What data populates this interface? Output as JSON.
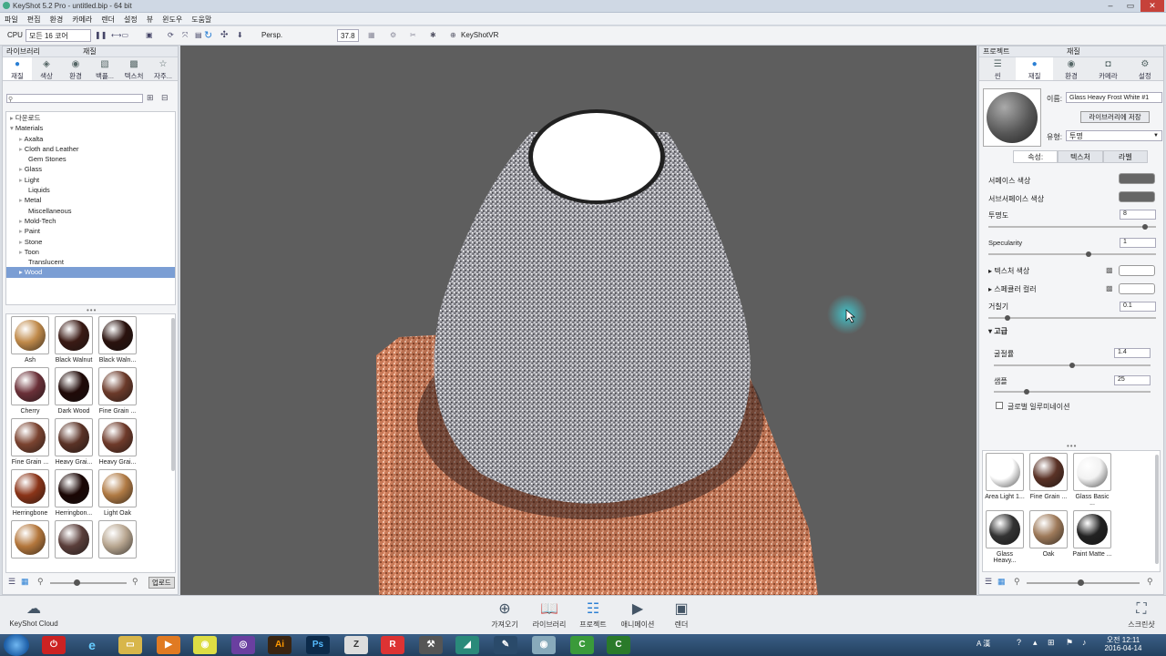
{
  "window": {
    "title": "KeyShot 5.2 Pro  - untitled.bip  - 64 bit"
  },
  "menu": [
    "파일",
    "편집",
    "환경",
    "카메라",
    "렌더",
    "설정",
    "뷰",
    "윈도우",
    "도움말"
  ],
  "toolbar": {
    "cpu_label": "CPU",
    "cpu_value": "모든 16 코어",
    "persp_label": "Persp.",
    "fov_value": "37.8",
    "keyshotvr_label": "KeyShotVR"
  },
  "library": {
    "header_left": "라이브러리",
    "header_title": "재질",
    "tabs": [
      {
        "label": "재질",
        "icon": "material-icon"
      },
      {
        "label": "색상",
        "icon": "color-icon"
      },
      {
        "label": "환경",
        "icon": "environment-icon"
      },
      {
        "label": "백플...",
        "icon": "backplate-icon"
      },
      {
        "label": "텍스처",
        "icon": "texture-icon"
      },
      {
        "label": "자주...",
        "icon": "favorites-icon"
      }
    ],
    "search_placeholder": "",
    "tree_root1": "다운로드",
    "tree_root2": "Materials",
    "tree": [
      "Axalta",
      "Cloth and Leather",
      "Gem Stones",
      "Glass",
      "Light",
      "Liquids",
      "Metal",
      "Miscellaneous",
      "Mold-Tech",
      "Paint",
      "Stone",
      "Toon",
      "Translucent",
      "Wood"
    ],
    "tree_selected": "Wood",
    "swatches": [
      {
        "label": "Ash",
        "color": "#c08a4a"
      },
      {
        "label": "Black Walnut",
        "color": "#3a1a14"
      },
      {
        "label": "Black Waln...",
        "color": "#2a120e"
      },
      {
        "label": "Cherry",
        "color": "#6a3038"
      },
      {
        "label": "Dark Wood",
        "color": "#200a08"
      },
      {
        "label": "Fine Grain ...",
        "color": "#6b3a2a"
      },
      {
        "label": "Fine Grain ...",
        "color": "#7a4330"
      },
      {
        "label": "Heavy Grai...",
        "color": "#5a3226"
      },
      {
        "label": "Heavy Grai...",
        "color": "#6e3a2a"
      },
      {
        "label": "Herringbone",
        "color": "#8a3418"
      },
      {
        "label": "Herringbon...",
        "color": "#1a0604"
      },
      {
        "label": "Light Oak",
        "color": "#b07a44"
      },
      {
        "label": "",
        "color": "#b4773c"
      },
      {
        "label": "",
        "color": "#5a3e3a"
      },
      {
        "label": "",
        "color": "#b8a690"
      }
    ],
    "upload_label": "업로드"
  },
  "viewport": {
    "bg": "#5e5e5e"
  },
  "project": {
    "header_left": "프로젝트",
    "header_title": "재질",
    "tabs": [
      {
        "label": "씬",
        "icon": "scene-icon"
      },
      {
        "label": "재질",
        "icon": "material-icon"
      },
      {
        "label": "환경",
        "icon": "environment-icon"
      },
      {
        "label": "카메라",
        "icon": "camera-icon"
      },
      {
        "label": "설정",
        "icon": "settings-icon"
      }
    ],
    "name_label": "이름:",
    "name_value": "Glass Heavy Frost White #1",
    "save_to_library": "라이브러리에 저장",
    "type_label": "유형:",
    "type_value": "투명",
    "subtabs": [
      "속성:",
      "텍스처",
      "라벨"
    ],
    "props": {
      "surface_color": "서페이스 색상",
      "subsurface_color": "서브서페이스 색상",
      "transparency": "투명도",
      "transparency_value": "8",
      "transparency_level": 0.95,
      "specularity": "Specularity",
      "specularity_value": "1",
      "specularity_level": 0.6,
      "texture_color": "텍스처 색상",
      "specular_color": "스페큘러 컬러",
      "roughness": "거칠기",
      "roughness_value": "0.1",
      "roughness_level": 0.1,
      "advanced": "고급",
      "refraction": "굴절률",
      "refraction_value": "1.4",
      "refraction_level": 0.5,
      "samples": "샘플",
      "samples_value": "25",
      "samples_level": 0.2,
      "global_illum": "글로벌 일루미네이션"
    },
    "swatches": [
      {
        "label": "Area Light 1...",
        "color": "#ffffff"
      },
      {
        "label": "Fine Grain ...",
        "color": "#5a3226"
      },
      {
        "label": "Glass Basic ...",
        "color": "#f2f2f2"
      },
      {
        "label": "Glass Heavy...",
        "color": "#333333"
      },
      {
        "label": "Oak",
        "color": "#9e7a5a"
      },
      {
        "label": "Paint Matte ...",
        "color": "#222222"
      }
    ]
  },
  "dock": [
    {
      "label": "가져오기",
      "icon": "import-icon"
    },
    {
      "label": "라이브러리",
      "icon": "library-icon"
    },
    {
      "label": "프로젝트",
      "icon": "project-icon"
    },
    {
      "label": "애니메이션",
      "icon": "animation-icon"
    },
    {
      "label": "렌더",
      "icon": "render-icon"
    }
  ],
  "dock_left": "KeyShot Cloud",
  "dock_right": "스크린샷",
  "taskbar": {
    "time": "오전 12:11",
    "date": "2016-04-14",
    "ime": "A 漢"
  }
}
